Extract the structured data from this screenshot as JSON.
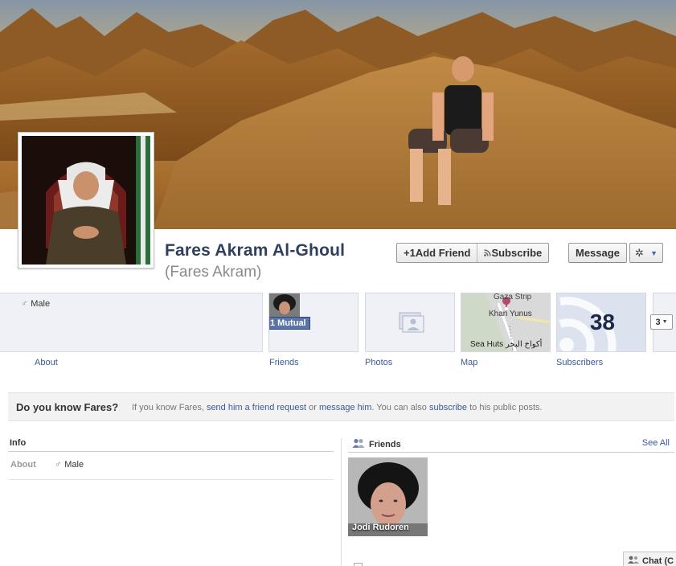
{
  "profile": {
    "name": "Fares Akram Al-Ghoul",
    "alt_name": "(Fares Akram)"
  },
  "actions": {
    "add_friend": "Add Friend",
    "subscribe": "Subscribe",
    "message": "Message"
  },
  "summary": {
    "gender": "Male",
    "about_label": "About",
    "friends_label": "Friends",
    "mutual_badge": "1 Mutual",
    "photos_label": "Photos",
    "map_label": "Map",
    "map_lines": [
      "Gaza Strip",
      "Khan Yunus",
      "Sea Huts أكواخ البحر"
    ],
    "subscribers_count": "38",
    "subscribers_label": "Subscribers",
    "more_count": "3"
  },
  "know_bar": {
    "question": "Do you know Fares?",
    "text_1": "If you know Fares, ",
    "link_friend": "send him a friend request",
    "text_2": " or ",
    "link_message": "message him",
    "text_3": ". You can also ",
    "link_subscribe": "subscribe",
    "text_4": " to his public posts."
  },
  "info": {
    "heading": "Info",
    "about_label": "About",
    "gender": "Male"
  },
  "friends": {
    "heading": "Friends",
    "see_all": "See All",
    "items": [
      {
        "name": "Jodi Rudoren"
      }
    ]
  },
  "chat": {
    "label": "Chat (C"
  },
  "icons": {
    "add_friend": "add-friend-icon",
    "subscribe": "rss-icon",
    "gear": "gear-icon",
    "male": "male-icon",
    "friends": "friends-icon",
    "chat": "chat-icon"
  },
  "colors": {
    "link": "#3b5998",
    "name": "#2f3f5f",
    "badge": "#5b74a8"
  }
}
